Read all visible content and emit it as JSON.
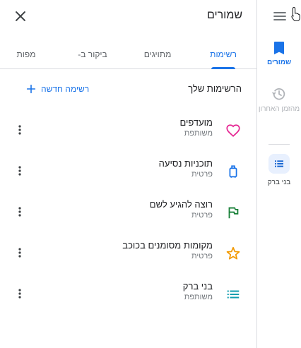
{
  "header": {
    "title": "שמורים"
  },
  "tabs": [
    {
      "label": "רשימות",
      "active": true
    },
    {
      "label": "מתויגים"
    },
    {
      "label": "ביקור ב-"
    },
    {
      "label": "מפות"
    }
  ],
  "lists_section": {
    "title": "הרשימות שלך",
    "new_list_label": "רשימה חדשה"
  },
  "lists": [
    {
      "name": "מועדפים",
      "privacy": "משותפת",
      "icon": "heart-icon",
      "color": "#e52592"
    },
    {
      "name": "תוכניות נסיעה",
      "privacy": "פרטית",
      "icon": "luggage-icon",
      "color": "#1a73e8"
    },
    {
      "name": "רוצה להגיע לשם",
      "privacy": "פרטית",
      "icon": "flag-icon",
      "color": "#188038"
    },
    {
      "name": "מקומות מסומנים בכוכב",
      "privacy": "פרטית",
      "icon": "star-icon",
      "color": "#f29900"
    },
    {
      "name": "בני ברק",
      "privacy": "משותפת",
      "icon": "list-icon",
      "color": "#129eaf"
    }
  ],
  "rail": {
    "saved_label": "שמורים",
    "history_label": "מהזמן האחרון",
    "list_label": "בני ברק"
  },
  "colors": {
    "accent": "#1a73e8",
    "divider": "#dadce0"
  }
}
